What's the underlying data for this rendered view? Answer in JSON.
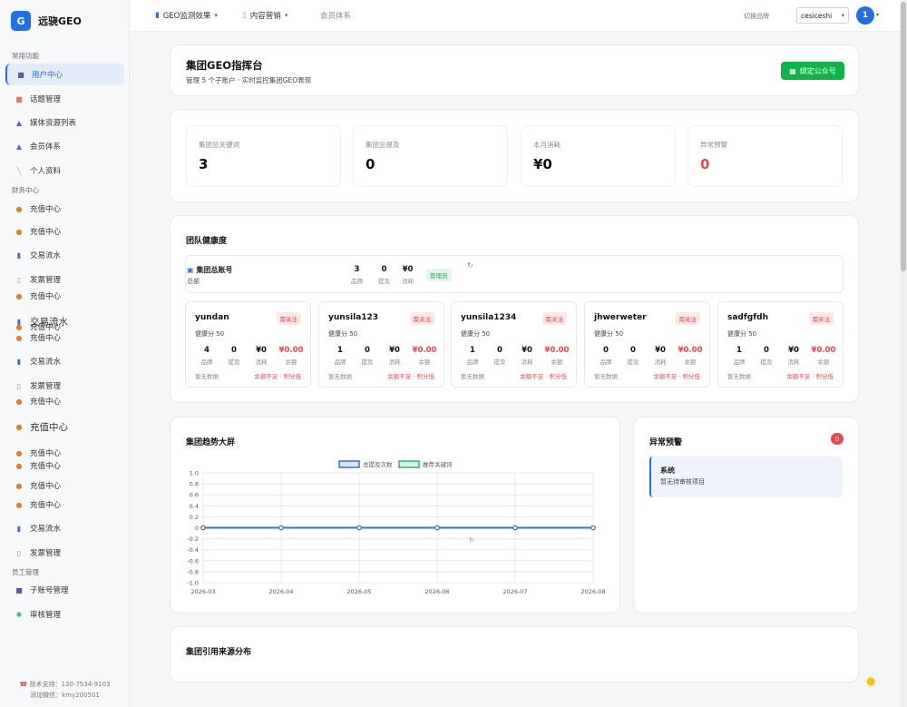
{
  "brand": {
    "logo": "G",
    "name": "远骁GEO"
  },
  "sidebar": {
    "sections": [
      "常用功能",
      "财务中心",
      "员工管理"
    ],
    "items": [
      {
        "label": "用户中心",
        "icon": "user-icon",
        "active": true
      },
      {
        "label": "话题管理",
        "icon": "topic-icon"
      },
      {
        "label": "媒体资源列表",
        "icon": "media-icon"
      },
      {
        "label": "会员体系",
        "icon": "member-icon"
      },
      {
        "label": "个人资料",
        "icon": "profile-icon"
      },
      {
        "label": "充值中心",
        "icon": "recharge-icon"
      },
      {
        "label": "充值中心",
        "icon": "recharge-icon"
      },
      {
        "label": "交易流水",
        "icon": "transactions-icon"
      },
      {
        "label": "发票管理",
        "icon": "invoice-icon"
      },
      {
        "label": "充值中心",
        "icon": "recharge-icon"
      },
      {
        "label": "交易流水",
        "icon": "transactions-icon"
      },
      {
        "label": "充值中心",
        "icon": "recharge-icon"
      },
      {
        "label": "充值中心",
        "icon": "recharge-icon"
      },
      {
        "label": "交易流水",
        "icon": "transactions-icon"
      },
      {
        "label": "发票管理",
        "icon": "invoice-icon"
      },
      {
        "label": "充值中心",
        "icon": "recharge-icon"
      },
      {
        "label": "充值中心",
        "icon": "recharge-icon"
      },
      {
        "label": "充值中心",
        "icon": "recharge-icon"
      },
      {
        "label": "充值中心",
        "icon": "recharge-icon"
      },
      {
        "label": "充值中心",
        "icon": "recharge-icon"
      },
      {
        "label": "充值中心",
        "icon": "recharge-icon"
      },
      {
        "label": "交易流水",
        "icon": "transactions-icon"
      },
      {
        "label": "发票管理",
        "icon": "invoice-icon"
      },
      {
        "label": "子账号管理",
        "icon": "subaccount-icon"
      },
      {
        "label": "审核管理",
        "icon": "review-icon"
      }
    ],
    "footer": {
      "support": "技术支持：130-7534-9103",
      "wechat": "添加微信：kmy200501"
    }
  },
  "topbar": {
    "menu1": "GEO监测效果",
    "menu2": "内容营销",
    "menu3": "会员体系",
    "switch_label": "切换品牌",
    "brand_value": "cesiceshi",
    "avatar": "1"
  },
  "header": {
    "title": "集团GEO指挥台",
    "subtitle": "管理 5 个子账户 · 实时监控集团GEO表现",
    "bind_button": "绑定公众号"
  },
  "stats": [
    {
      "label": "集团总关键词",
      "value": "3"
    },
    {
      "label": "集团总提及",
      "value": "0"
    },
    {
      "label": "本月消耗",
      "value": "¥0"
    },
    {
      "label": "异常预警",
      "value": "0"
    }
  ],
  "health": {
    "title": "团队健康度",
    "master": {
      "name": "集团总账号",
      "sub": "总部",
      "brand": "3",
      "mention": "0",
      "consume": "¥0",
      "brand_l": "品牌",
      "mention_l": "提及",
      "consume_l": "消耗",
      "badge": "管理员"
    },
    "teams": [
      {
        "name": "yundan",
        "tag": "需关注",
        "health": "健康分 50",
        "brand": "4",
        "mention": "0",
        "consume": "¥0",
        "balance": "¥0.00",
        "nodata": "暂无数据",
        "warn": "余额不足 · 积分低"
      },
      {
        "name": "yunsila123",
        "tag": "需关注",
        "health": "健康分 50",
        "brand": "1",
        "mention": "0",
        "consume": "¥0",
        "balance": "¥0.00",
        "nodata": "暂无数据",
        "warn": "余额不足 · 积分低"
      },
      {
        "name": "yunsila1234",
        "tag": "需关注",
        "health": "健康分 50",
        "brand": "1",
        "mention": "0",
        "consume": "¥0",
        "balance": "¥0.00",
        "nodata": "暂无数据",
        "warn": "余额不足 · 积分低"
      },
      {
        "name": "jhwerweter",
        "tag": "需关注",
        "health": "健康分 50",
        "brand": "0",
        "mention": "0",
        "consume": "¥0",
        "balance": "¥0.00",
        "nodata": "暂无数据",
        "warn": "余额不足 · 积分低"
      },
      {
        "name": "sadfgfdh",
        "tag": "需关注",
        "health": "健康分 50",
        "brand": "1",
        "mention": "0",
        "consume": "¥0",
        "balance": "¥0.00",
        "nodata": "暂无数据",
        "warn": "余额不足 · 积分低"
      }
    ],
    "col_labels": {
      "brand": "品牌",
      "mention": "提及",
      "consume": "消耗",
      "balance": "余额"
    }
  },
  "trend": {
    "title": "集团趋势大屏"
  },
  "chart_data": {
    "type": "line",
    "x": [
      "2026-03",
      "2026-04",
      "2026-05",
      "2026-06",
      "2026-07",
      "2026-08"
    ],
    "series": [
      {
        "name": "总提及次数",
        "values": [
          0,
          0,
          0,
          0,
          0,
          0
        ],
        "color": "#3b6fc4"
      },
      {
        "name": "推荐关键词",
        "values": [
          0,
          0,
          0,
          0,
          0,
          0
        ],
        "color": "#2bb673"
      }
    ],
    "ylim": [
      -1.0,
      1.0
    ],
    "yticks": [
      "1.0",
      "0.8",
      "0.6",
      "0.4",
      "0.2",
      "0",
      "-0.2",
      "-0.4",
      "-0.6",
      "-0.8",
      "-1.0"
    ],
    "legend": "top-center",
    "grid": true
  },
  "alerts": {
    "title": "异常预警",
    "count": "0",
    "item_title": "系统",
    "item_text": "暂无待审核项目"
  },
  "sources": {
    "title": "集团引用来源分布"
  },
  "colors": {
    "primary": "#1f6feb",
    "success": "#12b24a",
    "danger": "#e5484d"
  }
}
